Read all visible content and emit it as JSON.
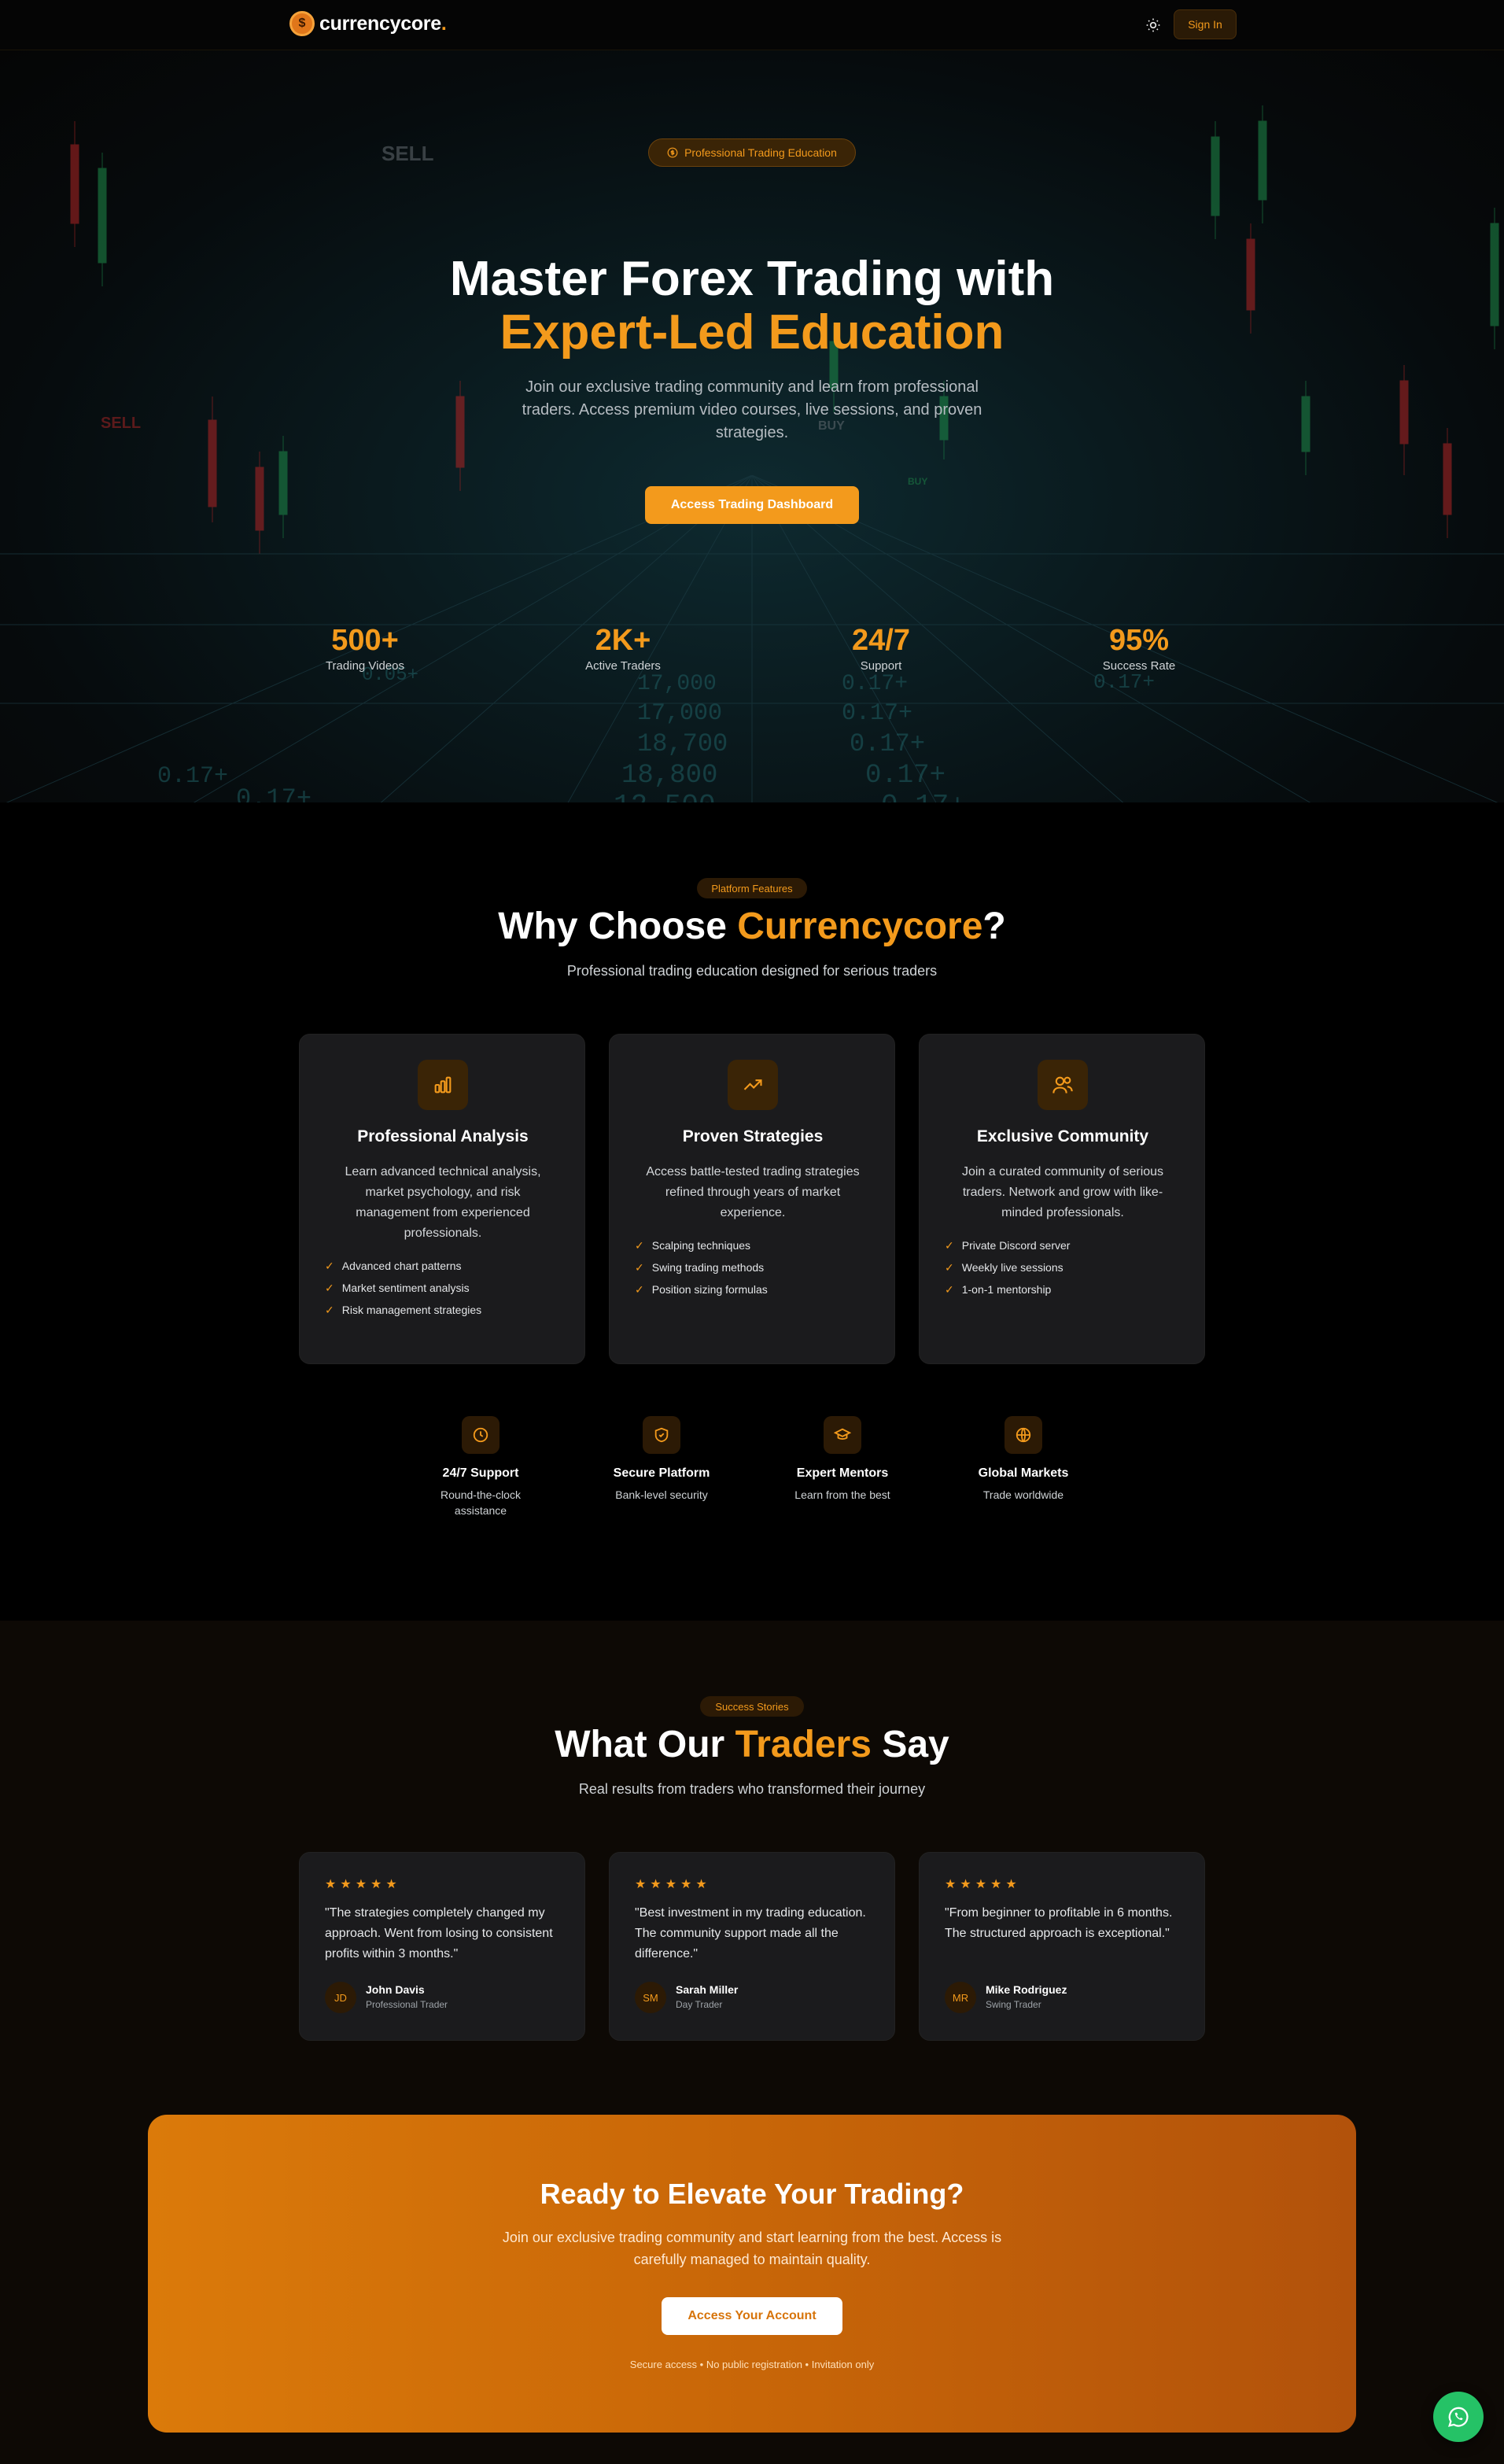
{
  "nav": {
    "logo_text": "currencycore",
    "logo_dot": ".",
    "logo_icon": "dollar-coin-icon",
    "theme_icon": "sun-icon",
    "signin_label": "Sign In"
  },
  "hero": {
    "badge": "Professional Trading Education",
    "badge_icon": "dollar-circle-icon",
    "title_line1": "Master Forex Trading with",
    "title_line2": "Expert-Led Education",
    "subtitle": "Join our exclusive trading community and learn from professional traders. Access premium video courses, live sessions, and proven strategies.",
    "cta_label": "Access Trading Dashboard",
    "stats": [
      {
        "value": "500+",
        "label": "Trading Videos"
      },
      {
        "value": "2K+",
        "label": "Active Traders"
      },
      {
        "value": "24/7",
        "label": "Support"
      },
      {
        "value": "95%",
        "label": "Success Rate"
      }
    ],
    "background_words": {
      "sell_top": "SELL",
      "sell_left": "SELL",
      "buy": "BUY",
      "buy_small": "BUY"
    }
  },
  "features": {
    "pill": "Platform Features",
    "title_part1": "Why Choose ",
    "title_accent": "Currencycore",
    "title_part2": "?",
    "subtitle": "Professional trading education designed for serious traders",
    "cards": [
      {
        "icon": "bar-chart-icon",
        "title": "Professional Analysis",
        "description": "Learn advanced technical analysis, market psychology, and risk management from experienced professionals.",
        "items": [
          "Advanced chart patterns",
          "Market sentiment analysis",
          "Risk management strategies"
        ]
      },
      {
        "icon": "trending-up-icon",
        "title": "Proven Strategies",
        "description": "Access battle-tested trading strategies refined through years of market experience.",
        "items": [
          "Scalping techniques",
          "Swing trading methods",
          "Position sizing formulas"
        ]
      },
      {
        "icon": "users-icon",
        "title": "Exclusive Community",
        "description": "Join a curated community of serious traders. Network and grow with like-minded professionals.",
        "items": [
          "Private Discord server",
          "Weekly live sessions",
          "1-on-1 mentorship"
        ]
      }
    ],
    "minis": [
      {
        "icon": "clock-icon",
        "title": "24/7 Support",
        "sub": "Round-the-clock assistance"
      },
      {
        "icon": "shield-icon",
        "title": "Secure Platform",
        "sub": "Bank-level security"
      },
      {
        "icon": "graduation-cap-icon",
        "title": "Expert Mentors",
        "sub": "Learn from the best"
      },
      {
        "icon": "globe-icon",
        "title": "Global Markets",
        "sub": "Trade worldwide"
      }
    ]
  },
  "testimonials": {
    "pill": "Success Stories",
    "title_part1": "What Our ",
    "title_accent": "Traders",
    "title_part2": " Say",
    "subtitle": "Real results from traders who transformed their journey",
    "stars": "★★★★★",
    "items": [
      {
        "quote": "\"The strategies completely changed my approach. Went from losing to consistent profits within 3 months.\"",
        "initials": "JD",
        "name": "John Davis",
        "role": "Professional Trader"
      },
      {
        "quote": "\"Best investment in my trading education. The community support made all the difference.\"",
        "initials": "SM",
        "name": "Sarah Miller",
        "role": "Day Trader"
      },
      {
        "quote": "\"From beginner to profitable in 6 months. The structured approach is exceptional.\"",
        "initials": "MR",
        "name": "Mike Rodriguez",
        "role": "Swing Trader"
      }
    ]
  },
  "cta": {
    "title": "Ready to Elevate Your Trading?",
    "subtitle": "Join our exclusive trading community and start learning from the best. Access is carefully managed to maintain quality.",
    "button": "Access Your Account",
    "note": "Secure access • No public registration • Invitation only"
  },
  "whatsapp_icon": "whatsapp-icon",
  "colors": {
    "accent": "#f39a1c",
    "background": "#000000",
    "card": "#1b1b1d",
    "cta_start": "#db7a0a",
    "cta_end": "#b2520b",
    "whatsapp": "#25c266"
  }
}
